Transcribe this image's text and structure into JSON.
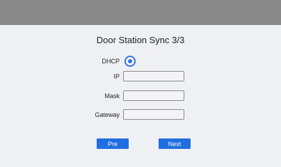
{
  "header": {},
  "title": "Door Station Sync 3/3",
  "dhcp": {
    "label": "DHCP",
    "selected": true
  },
  "fields": {
    "ip": {
      "label": "IP",
      "value": "",
      "placeholder": ""
    },
    "mask": {
      "label": "Mask",
      "value": "",
      "placeholder": ""
    },
    "gateway": {
      "label": "Gateway",
      "value": "",
      "placeholder": ""
    }
  },
  "buttons": {
    "pre": "Pre",
    "next": "Next"
  },
  "colors": {
    "accent": "#1f6fe0",
    "header": "#898989",
    "background": "#eef0f4"
  },
  "icons": {
    "dhcp_radio": "radio-selected-icon"
  }
}
